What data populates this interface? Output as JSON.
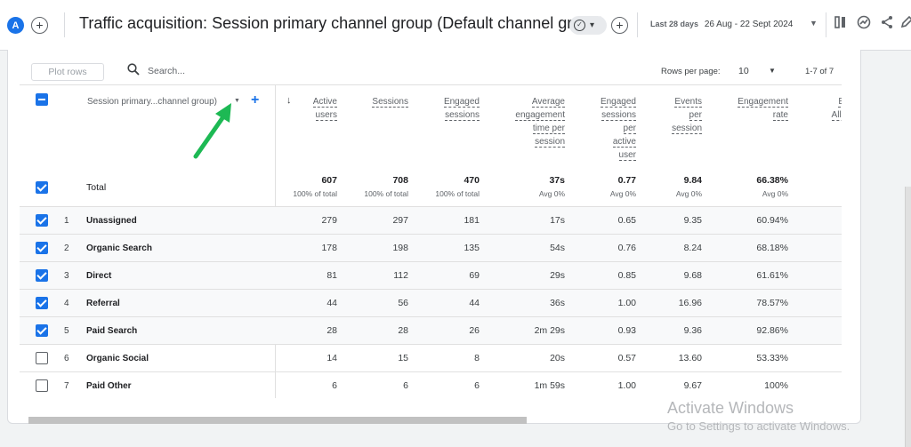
{
  "header": {
    "avatar_letter": "A",
    "title": "Traffic acquisition: Session primary channel group (Default channel group)",
    "date_range_label": "Last 28 days",
    "date_range": "26 Aug - 22 Sept 2024",
    "icons": [
      "plus-icon",
      "check-circle-icon",
      "compare-icon",
      "insights-icon",
      "share-icon",
      "edit-icon"
    ]
  },
  "toolbar": {
    "plot_rows": "Plot rows",
    "search_placeholder": "Search...",
    "rows_per_page_label": "Rows per page:",
    "rows_per_page_value": "10",
    "pagination": "1-7 of 7"
  },
  "table": {
    "dimension_header": "Session primary...channel group)",
    "columns": [
      {
        "lines": [
          "Active",
          "users"
        ]
      },
      {
        "lines": [
          "Sessions"
        ]
      },
      {
        "lines": [
          "Engaged",
          "sessions"
        ]
      },
      {
        "lines": [
          "Average",
          "engagement",
          "time per",
          "session"
        ]
      },
      {
        "lines": [
          "Engaged",
          "sessions",
          "per",
          "active",
          "user"
        ]
      },
      {
        "lines": [
          "Events",
          "per",
          "session"
        ]
      },
      {
        "lines": [
          "Engagement",
          "rate"
        ]
      },
      {
        "lines": [
          "Ev",
          "All e"
        ]
      }
    ],
    "total": {
      "label": "Total",
      "values": [
        "607",
        "708",
        "470",
        "37s",
        "0.77",
        "9.84",
        "66.38%"
      ],
      "subs": [
        "100% of total",
        "100% of total",
        "100% of total",
        "Avg 0%",
        "Avg 0%",
        "Avg 0%",
        "Avg 0%"
      ]
    },
    "rows": [
      {
        "num": "1",
        "label": "Unassigned",
        "checked": true,
        "values": [
          "279",
          "297",
          "181",
          "17s",
          "0.65",
          "9.35",
          "60.94%"
        ]
      },
      {
        "num": "2",
        "label": "Organic Search",
        "checked": true,
        "values": [
          "178",
          "198",
          "135",
          "54s",
          "0.76",
          "8.24",
          "68.18%"
        ]
      },
      {
        "num": "3",
        "label": "Direct",
        "checked": true,
        "values": [
          "81",
          "112",
          "69",
          "29s",
          "0.85",
          "9.68",
          "61.61%"
        ]
      },
      {
        "num": "4",
        "label": "Referral",
        "checked": true,
        "values": [
          "44",
          "56",
          "44",
          "36s",
          "1.00",
          "16.96",
          "78.57%"
        ]
      },
      {
        "num": "5",
        "label": "Paid Search",
        "checked": true,
        "values": [
          "28",
          "28",
          "26",
          "2m 29s",
          "0.93",
          "9.36",
          "92.86%"
        ]
      },
      {
        "num": "6",
        "label": "Organic Social",
        "checked": false,
        "values": [
          "14",
          "15",
          "8",
          "20s",
          "0.57",
          "13.60",
          "53.33%"
        ]
      },
      {
        "num": "7",
        "label": "Paid Other",
        "checked": false,
        "values": [
          "6",
          "6",
          "6",
          "1m 59s",
          "1.00",
          "9.67",
          "100%"
        ]
      }
    ]
  },
  "watermark": {
    "title": "Activate Windows",
    "subtitle": "Go to Settings to activate Windows."
  },
  "colors": {
    "accent": "#1a73e8",
    "arrow": "#1db954",
    "row_shade": "#f8f9fa"
  }
}
